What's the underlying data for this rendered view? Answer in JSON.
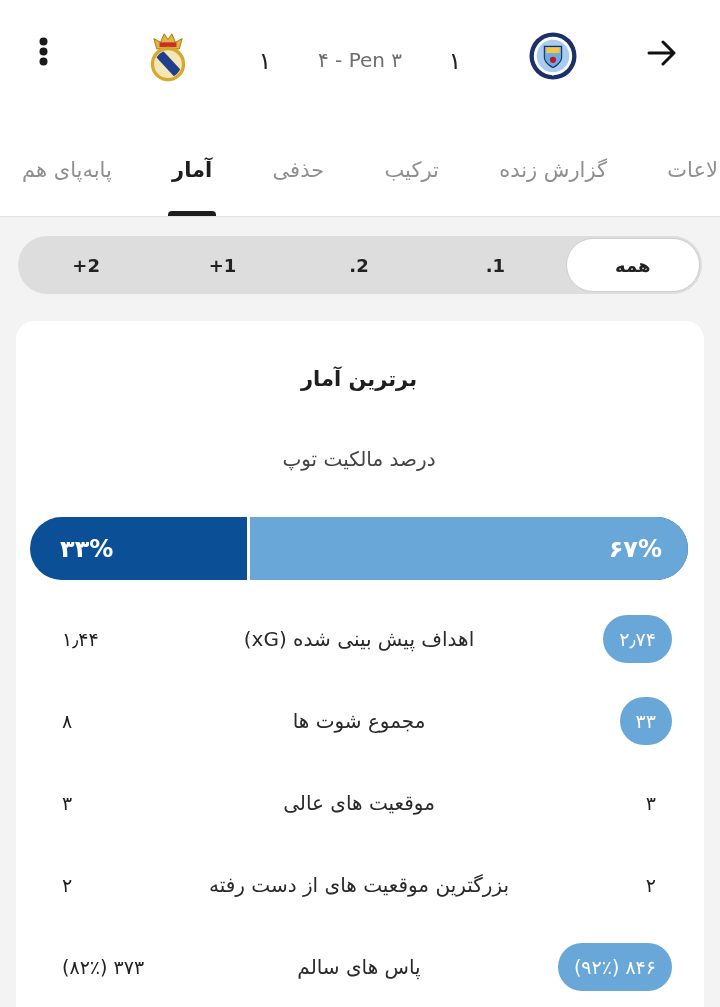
{
  "header": {
    "home_score": "۱",
    "penalties": "۴ - Pen ۳",
    "away_score": "۱"
  },
  "tabs": [
    {
      "label": "لاعات",
      "selected": false
    },
    {
      "label": "گزارش زنده",
      "selected": false
    },
    {
      "label": "ترکیب",
      "selected": false
    },
    {
      "label": "حذفی",
      "selected": false
    },
    {
      "label": "آمار",
      "selected": true
    },
    {
      "label": "پابه‌پای هم",
      "selected": false
    }
  ],
  "period_filter": [
    {
      "label": "همه",
      "selected": true
    },
    {
      "label": ".1",
      "selected": false
    },
    {
      "label": ".2",
      "selected": false
    },
    {
      "label": "+1",
      "selected": false
    },
    {
      "label": "+2",
      "selected": false
    }
  ],
  "top_stats": {
    "title": "برترین آمار",
    "possession": {
      "label": "درصد مالکیت توپ",
      "home_value": "۶۷%",
      "away_value": "۳۳%",
      "level": 0.67
    },
    "rows": [
      {
        "label": "اهداف پیش بینی شده (xG)",
        "home": "۲٫۷۴",
        "away": "۱٫۴۴",
        "home_highlighted": true,
        "away_highlighted": false
      },
      {
        "label": "مجموع شوت ها",
        "home": "۳۳",
        "away": "۸",
        "home_highlighted": true,
        "away_highlighted": false
      },
      {
        "label": "موقعیت های عالی",
        "home": "۳",
        "away": "۳",
        "home_highlighted": false,
        "away_highlighted": false
      },
      {
        "label": "بزرگترین موقعیت های از دست رفته",
        "home": "۲",
        "away": "۲",
        "home_highlighted": false,
        "away_highlighted": false
      },
      {
        "label": "پاس های سالم",
        "home": "۸۴۶ (۹۲٪)",
        "away": "۳۷۳ (۸۲٪)",
        "home_highlighted": true,
        "away_highlighted": false
      }
    ]
  }
}
